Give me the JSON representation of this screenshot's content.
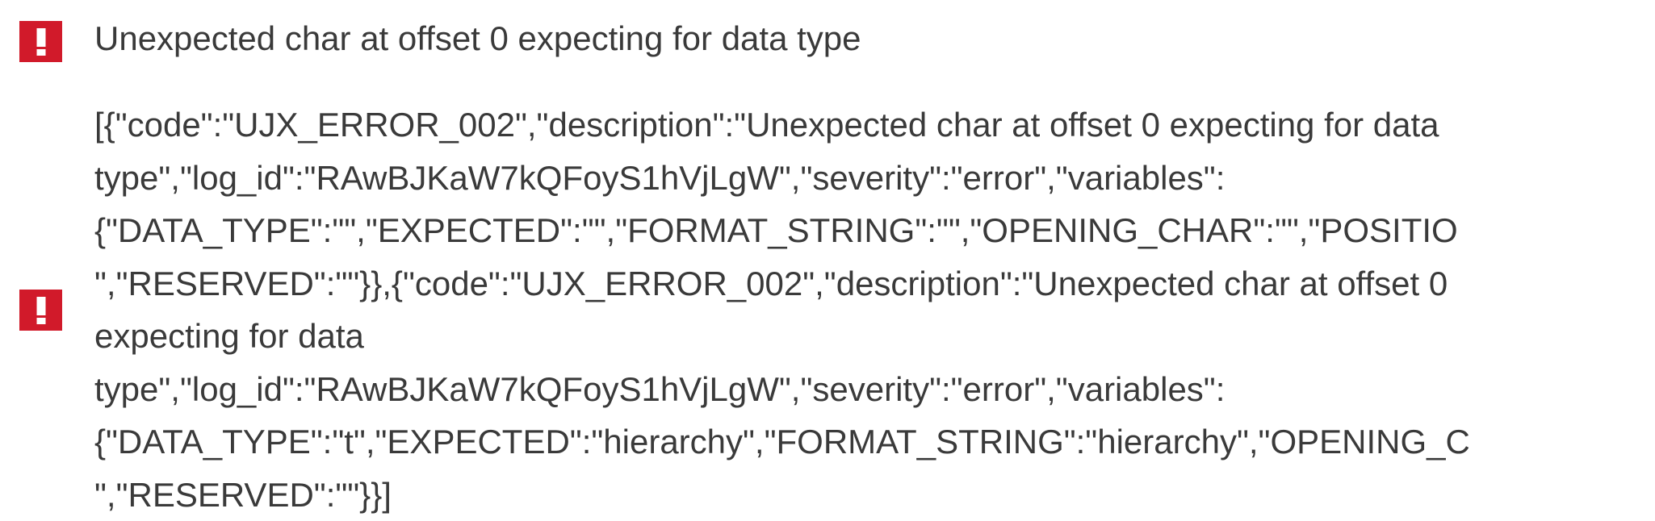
{
  "errors": [
    {
      "icon": "error-exclamation-icon",
      "message": "Unexpected char at offset 0 expecting for data type"
    },
    {
      "icon": "error-exclamation-icon",
      "details_lines": [
        "[{\"code\":\"UJX_ERROR_002\",\"description\":\"Unexpected char at offset 0 expecting for data",
        "type\",\"log_id\":\"RAwBJKaW7kQFoyS1hVjLgW\",\"severity\":\"error\",\"variables\":",
        "{\"DATA_TYPE\":\"\",\"EXPECTED\":\"\",\"FORMAT_STRING\":\"\",\"OPENING_CHAR\":\"\",\"POSITIO",
        "\",\"RESERVED\":\"\"}},{\"code\":\"UJX_ERROR_002\",\"description\":\"Unexpected char at offset 0",
        "expecting for data",
        "type\",\"log_id\":\"RAwBJKaW7kQFoyS1hVjLgW\",\"severity\":\"error\",\"variables\":",
        "{\"DATA_TYPE\":\"t\",\"EXPECTED\":\"hierarchy\",\"FORMAT_STRING\":\"hierarchy\",\"OPENING_C",
        "\",\"RESERVED\":\"\"}}]"
      ]
    }
  ],
  "colors": {
    "error_icon_bg": "#d11a2a",
    "text": "#3a3a3a",
    "background": "#ffffff"
  }
}
